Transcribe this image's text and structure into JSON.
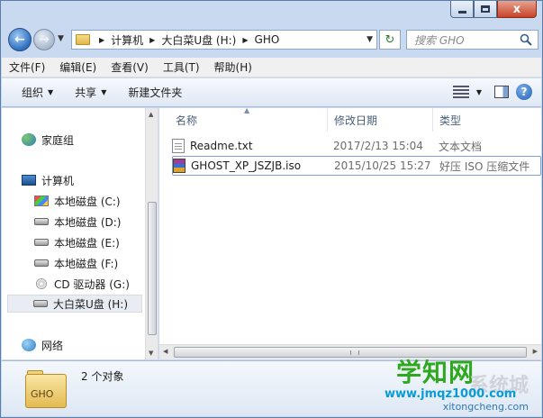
{
  "window": {
    "caption_close": "x"
  },
  "nav": {
    "back_glyph": "←",
    "forward_glyph": "→",
    "refresh_glyph": "↻",
    "breadcrumb": [
      "计算机",
      "大白菜U盘 (H:)",
      "GHO"
    ],
    "search_placeholder": "搜索 GHO"
  },
  "menubar": {
    "items": [
      "文件(F)",
      "编辑(E)",
      "查看(V)",
      "工具(T)",
      "帮助(H)"
    ]
  },
  "toolbar": {
    "organize": "组织",
    "share": "共享",
    "new_folder": "新建文件夹",
    "help_glyph": "?"
  },
  "navpane": {
    "homegroup": "家庭组",
    "computer": "计算机",
    "drives": [
      "本地磁盘 (C:)",
      "本地磁盘 (D:)",
      "本地磁盘 (E:)",
      "本地磁盘 (F:)",
      "CD 驱动器 (G:)",
      "大白菜U盘 (H:)"
    ],
    "network": "网络"
  },
  "files": {
    "columns": {
      "name": "名称",
      "date": "修改日期",
      "type": "类型"
    },
    "rows": [
      {
        "name": "Readme.txt",
        "date": "2017/2/13 15:04",
        "type": "文本文档",
        "icon": "text-file-icon"
      },
      {
        "name": "GHOST_XP_JSZJB.iso",
        "date": "2015/10/25 15:27",
        "type": "好压 ISO 压缩文件",
        "icon": "archive-file-icon"
      }
    ]
  },
  "details": {
    "folder_label": "GHO",
    "item_count": "2 个对象"
  },
  "watermark": {
    "main": "学知网",
    "sub": "系统城",
    "url": "www.jmqz1000.com",
    "url2": "xitongcheng.com"
  },
  "colors": {
    "frame": "#c9daf0",
    "selection_border": "#7da2ce",
    "watermark_green": "#2ea81e"
  }
}
